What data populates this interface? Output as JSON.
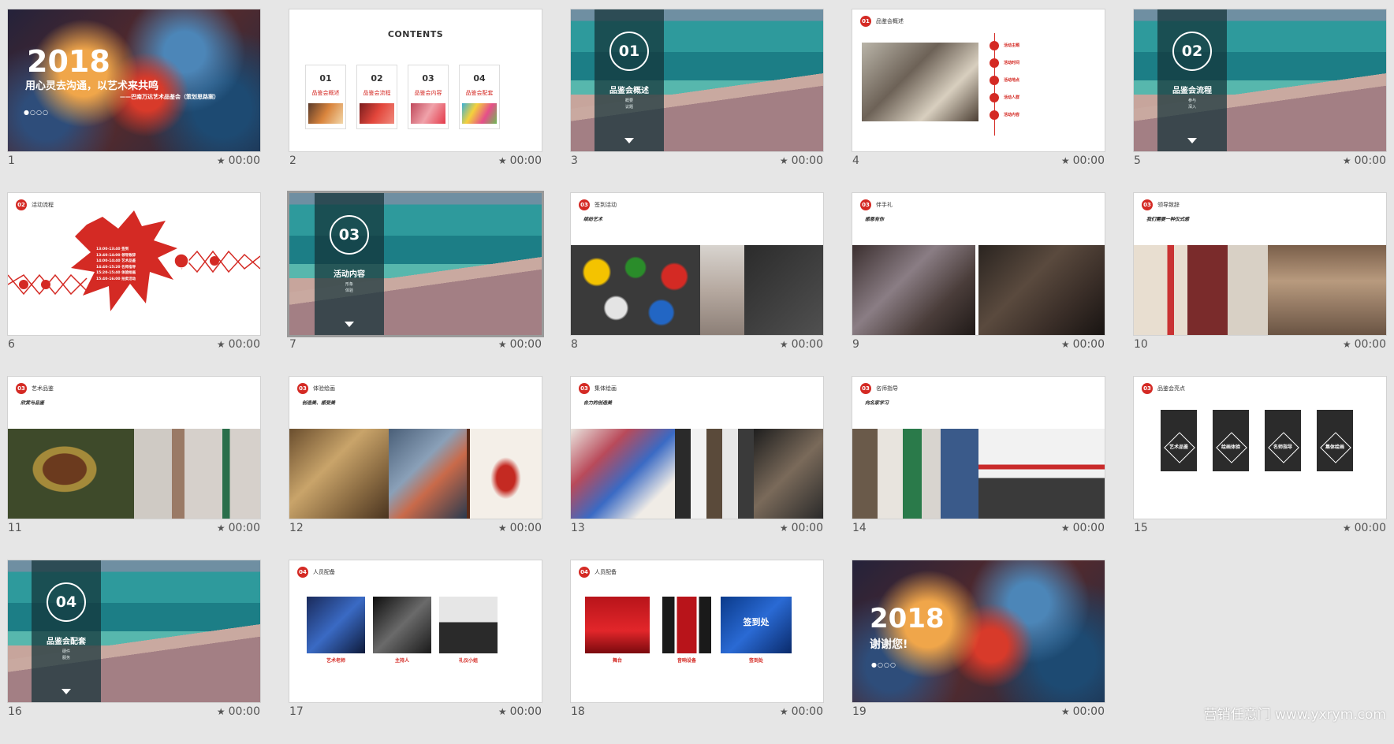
{
  "slides": [
    {
      "num": "1",
      "time": "00:00",
      "year": "2018",
      "line1": "用心灵去沟通，以艺术来共鸣",
      "line2": "——巴南万达艺术品鉴会（策划思路案）",
      "dots": "●○○○"
    },
    {
      "num": "2",
      "time": "00:00",
      "title": "CONTENTS",
      "items": [
        {
          "n": "01",
          "t": "品鉴会概述"
        },
        {
          "n": "02",
          "t": "品鉴会流程"
        },
        {
          "n": "03",
          "t": "品鉴会内容"
        },
        {
          "n": "04",
          "t": "品鉴会配套"
        }
      ]
    },
    {
      "num": "3",
      "time": "00:00",
      "n": "01",
      "title": "品鉴会概述",
      "sub1": "概要",
      "sub2": "议题"
    },
    {
      "num": "4",
      "time": "00:00",
      "head": "品鉴会概述",
      "items": [
        "活动主题",
        "活动时间",
        "活动地点",
        "活动人群",
        "活动内容"
      ]
    },
    {
      "num": "5",
      "time": "00:00",
      "n": "02",
      "title": "品鉴会流程",
      "sub1": "参与",
      "sub2": "深入"
    },
    {
      "num": "6",
      "time": "00:00",
      "head": "活动流程",
      "schedule": [
        "13:00-13:40 签到",
        "13:40-14:00 领导致辞",
        "14:00-14:40 艺术品鉴",
        "14:40-15:20 名师指导",
        "15:20-15:40 体验绘画",
        "15:40-16:00 拍卖活动"
      ]
    },
    {
      "num": "7",
      "time": "00:00",
      "n": "03",
      "title": "活动内容",
      "sub1": "形象",
      "sub2": "体验"
    },
    {
      "num": "8",
      "time": "00:00",
      "head": "签到活动",
      "subhead": "缤纷艺术"
    },
    {
      "num": "9",
      "time": "00:00",
      "head": "伴手礼",
      "subhead": "感恩有你"
    },
    {
      "num": "10",
      "time": "00:00",
      "head": "领导致辞",
      "subhead": "我们需要一种仪式感"
    },
    {
      "num": "11",
      "time": "00:00",
      "head": "艺术品鉴",
      "subhead": "欣赏与品鉴"
    },
    {
      "num": "12",
      "time": "00:00",
      "head": "体验绘画",
      "subhead": "创造美、感受美"
    },
    {
      "num": "13",
      "time": "00:00",
      "head": "集体绘画",
      "subhead": "合力的创造美"
    },
    {
      "num": "14",
      "time": "00:00",
      "head": "名师指导",
      "subhead": "向名家学习"
    },
    {
      "num": "15",
      "time": "00:00",
      "head": "品鉴会亮点",
      "cards": [
        "艺术品鉴",
        "绘画体验",
        "名师指导",
        "集体绘画"
      ]
    },
    {
      "num": "16",
      "time": "00:00",
      "n": "04",
      "title": "品鉴会配套",
      "sub1": "硬件",
      "sub2": "服务"
    },
    {
      "num": "17",
      "time": "00:00",
      "head": "人员配备",
      "captions": [
        "艺术老师",
        "主持人",
        "礼仪小姐"
      ]
    },
    {
      "num": "18",
      "time": "00:00",
      "head": "人员配备",
      "captions": [
        "舞台",
        "音响设备",
        "签到处"
      ],
      "sign": "签到处"
    },
    {
      "num": "19",
      "time": "00:00",
      "year": "2018",
      "thanks": "谢谢您!",
      "dots": "●○○○"
    }
  ],
  "watermark": "营销任意门 www.yxrym.com",
  "selected_slide": "7",
  "colors": {
    "accent": "#d42a24",
    "background": "#e6e6e6"
  }
}
